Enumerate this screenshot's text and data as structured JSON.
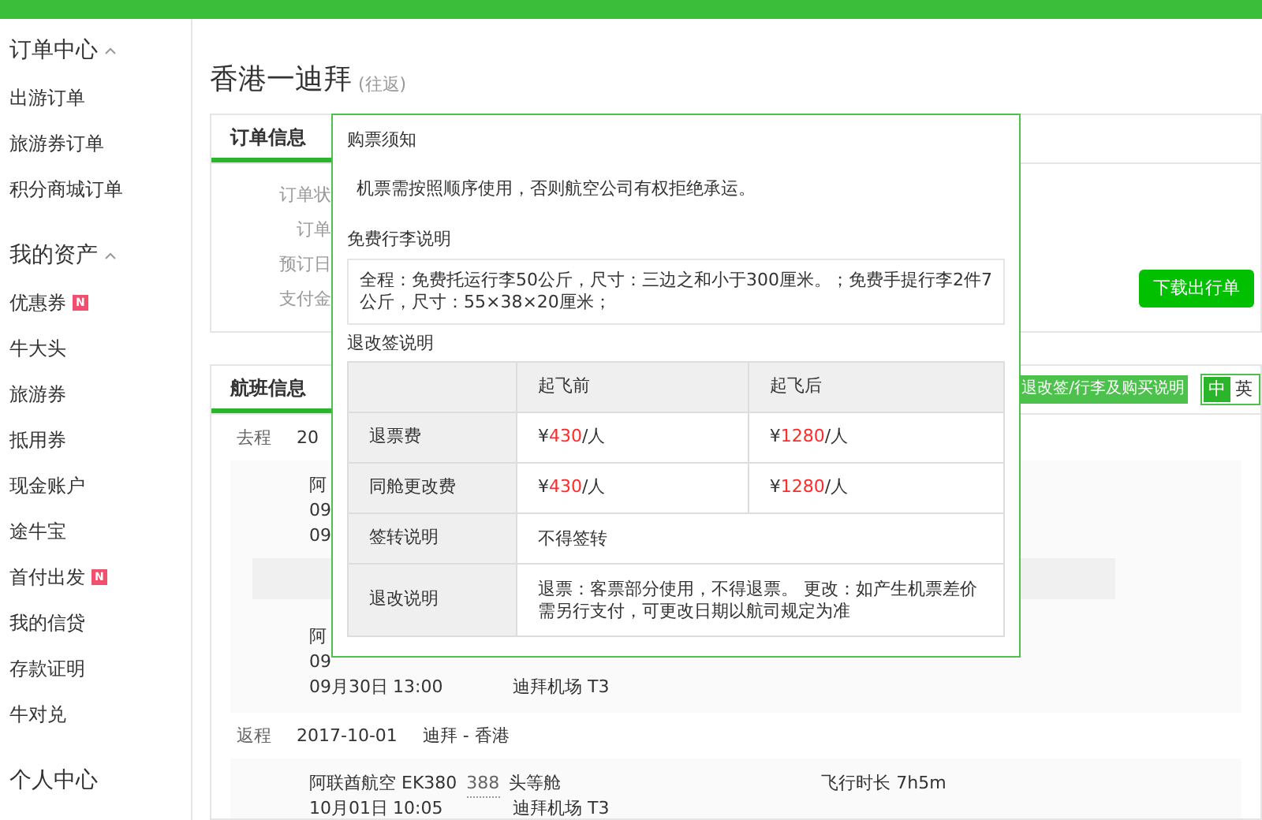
{
  "sidebar": {
    "sections": [
      {
        "title": "订单中心",
        "expanded": true,
        "items": [
          {
            "label": "出游订单"
          },
          {
            "label": "旅游券订单"
          },
          {
            "label": "积分商城订单"
          }
        ]
      },
      {
        "title": "我的资产",
        "expanded": true,
        "items": [
          {
            "label": "优惠券",
            "badge": "N"
          },
          {
            "label": "牛大头"
          },
          {
            "label": "旅游券"
          },
          {
            "label": "抵用券"
          },
          {
            "label": "现金账户"
          },
          {
            "label": "途牛宝"
          },
          {
            "label": "首付出发",
            "badge": "N"
          },
          {
            "label": "我的信贷"
          },
          {
            "label": "存款证明"
          },
          {
            "label": "牛对兑"
          }
        ]
      },
      {
        "title": "个人中心"
      }
    ]
  },
  "page_title": {
    "route": "香港一迪拜",
    "trip_type": "(往返)"
  },
  "order_card": {
    "tabs": [
      {
        "label": "订单信息",
        "selected": true
      }
    ],
    "labels": [
      "订单状",
      "订单",
      "预订日",
      "支付金"
    ],
    "download_button": "下载出行单"
  },
  "flight_card": {
    "tabs": [
      {
        "label": "航班信息",
        "selected": true
      }
    ],
    "policy_link": "退改签/行李及购买说明",
    "language_toggle": [
      {
        "label": "中",
        "selected": true
      },
      {
        "label": "英",
        "selected": false
      }
    ],
    "legs": [
      {
        "direction": "去程",
        "date": "20",
        "segments": [
          {
            "lines": [
              [
                "阿"
              ],
              [
                "09"
              ],
              [
                "09"
              ]
            ]
          },
          {
            "lines": [
              [
                "阿"
              ],
              [
                "09"
              ],
              [
                "09月30日",
                "13:00",
                "迪拜机场 T3"
              ]
            ]
          }
        ]
      },
      {
        "direction": "返程",
        "date": "2017-10-01",
        "route": "迪拜 - 香港",
        "segments": [
          {
            "airline": "阿联酋航空 EK380",
            "aircraft": "388",
            "cabin": "头等舱",
            "duration": "飞行时长 7h5m",
            "lines": [
              [
                "10月01日",
                "10:05",
                "迪拜机场 T3"
              ]
            ]
          }
        ]
      }
    ]
  },
  "notice_popup": {
    "title": "购票须知",
    "notice": "机票需按照顺序使用，否则航空公司有权拒绝承运。",
    "baggage_title": "免费行李说明",
    "baggage_text": "全程：免费托运行李50公斤，尺寸：三边之和小于300厘米。；免费手提行李2件7公斤，尺寸：55×38×20厘米；",
    "rules_title": "退改签说明",
    "rules_table": {
      "columns": [
        "起飞前",
        "起飞后"
      ],
      "rows": [
        {
          "kind": "prices",
          "label": "退票费",
          "cells": [
            {
              "currency": "¥",
              "amount": "430",
              "unit": "/人"
            },
            {
              "currency": "¥",
              "amount": "1280",
              "unit": "/人"
            }
          ]
        },
        {
          "kind": "prices",
          "label": "同舱更改费",
          "cells": [
            {
              "currency": "¥",
              "amount": "430",
              "unit": "/人"
            },
            {
              "currency": "¥",
              "amount": "1280",
              "unit": "/人"
            }
          ]
        },
        {
          "kind": "text",
          "label": "签转说明",
          "text": "不得签转"
        },
        {
          "kind": "text",
          "label": "退改说明",
          "text": "退票：客票部分使用，不得退票。 更改：如产生机票差价需另行支付，可更改日期以航司规定为准"
        }
      ]
    }
  }
}
